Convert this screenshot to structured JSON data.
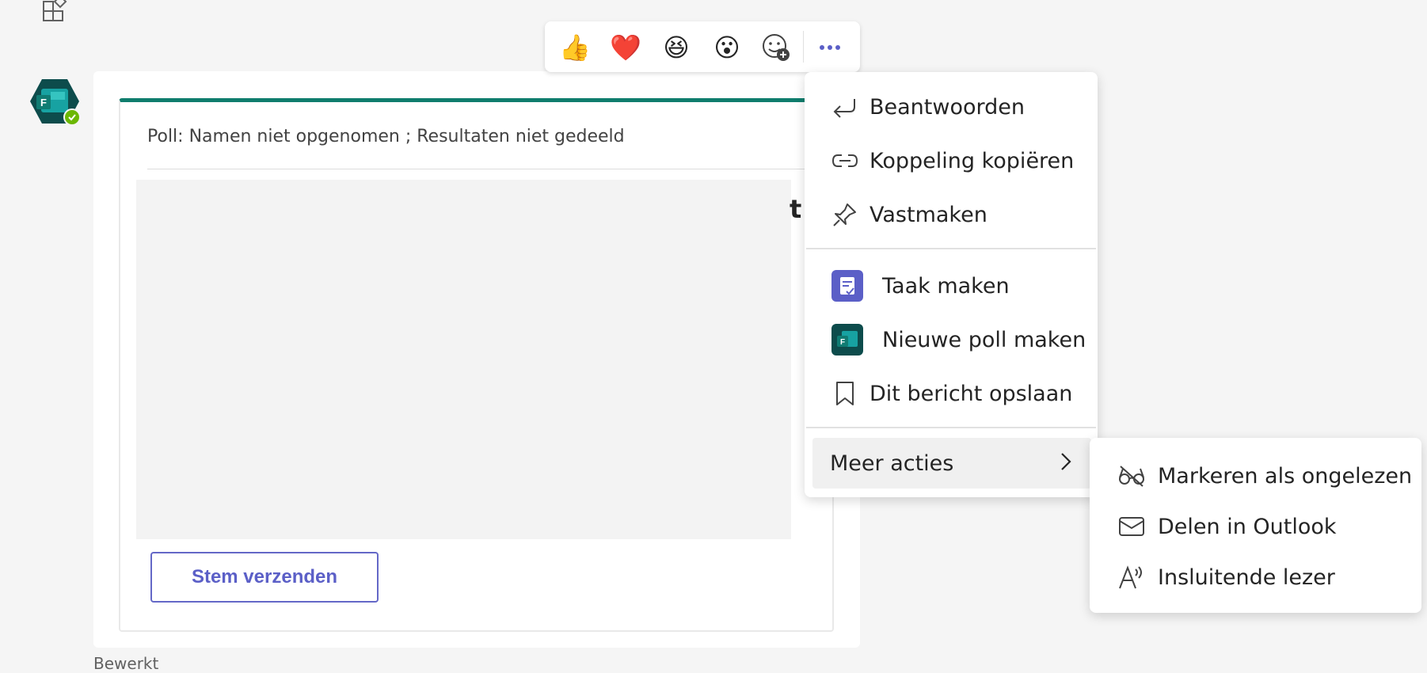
{
  "card": {
    "header": "Poll: Namen niet opgenomen ; Resultaten niet gedeeld",
    "clipped_title": "t",
    "submit_label": "Stem verzenden",
    "edited_label": "Bewerkt"
  },
  "reactions": [
    {
      "name": "thumbs-up",
      "glyph": "👍"
    },
    {
      "name": "heart",
      "glyph": "❤️"
    },
    {
      "name": "laugh",
      "glyph": "😆"
    },
    {
      "name": "surprised",
      "glyph": "😮"
    }
  ],
  "context_menu": {
    "items": [
      {
        "label": "Beantwoorden",
        "icon": "reply-icon"
      },
      {
        "label": "Koppeling kopiëren",
        "icon": "link-icon"
      },
      {
        "label": "Vastmaken",
        "icon": "pin-icon"
      },
      {
        "label": "Taak maken",
        "icon": "tasks-app-icon"
      },
      {
        "label": "Nieuwe poll maken",
        "icon": "forms-app-icon"
      },
      {
        "label": "Dit bericht opslaan",
        "icon": "bookmark-icon"
      }
    ],
    "more_actions": "Meer acties"
  },
  "submenu": {
    "items": [
      {
        "label": "Markeren als ongelezen",
        "icon": "glasses-off-icon"
      },
      {
        "label": "Delen in Outlook",
        "icon": "mail-icon"
      },
      {
        "label": "Insluitende lezer",
        "icon": "immersive-reader-icon"
      }
    ]
  },
  "colors": {
    "accent": "#5b5fc7",
    "card_top": "#0f7d6d",
    "status": "#6bb700"
  }
}
